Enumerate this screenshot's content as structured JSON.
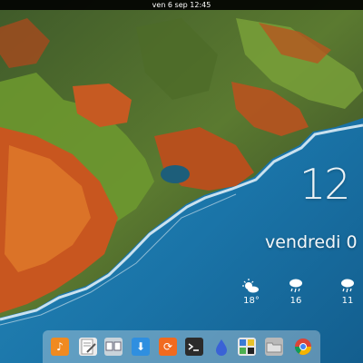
{
  "topbar": {
    "datetime": "ven  6 sep 12:45"
  },
  "widget": {
    "time": "12",
    "date": "vendredi 0",
    "forecast": [
      {
        "icon": "partly-sunny-icon",
        "temp": "18°"
      },
      {
        "icon": "rain-cloud-icon",
        "temp": "16"
      },
      {
        "icon": "rain-cloud-icon",
        "temp": "11"
      }
    ]
  },
  "dock": {
    "apps": [
      {
        "name": "music-app",
        "icon": "music-note-icon",
        "color": "#f08a20"
      },
      {
        "name": "text-editor-app",
        "icon": "pencil-doc-icon",
        "color": "#e9e9e9"
      },
      {
        "name": "window-switcher-app",
        "icon": "windows-icon",
        "color": "#c8d2d9"
      },
      {
        "name": "downloader-app",
        "icon": "download-arrow-icon",
        "color": "#2f8fe0"
      },
      {
        "name": "update-app",
        "icon": "sync-icon",
        "color": "#f16a1f"
      },
      {
        "name": "terminal-app",
        "icon": "terminal-icon",
        "color": "#2b2b2b"
      },
      {
        "name": "ink-app",
        "icon": "drop-icon",
        "color": "#3a62d6"
      },
      {
        "name": "settings-app",
        "icon": "tiles-icon",
        "color": "#e0e0e0"
      },
      {
        "name": "files-app",
        "icon": "folder-icon",
        "color": "#b8b8b8"
      },
      {
        "name": "browser-app",
        "icon": "chrome-icon",
        "color": "#ffffff"
      }
    ]
  }
}
